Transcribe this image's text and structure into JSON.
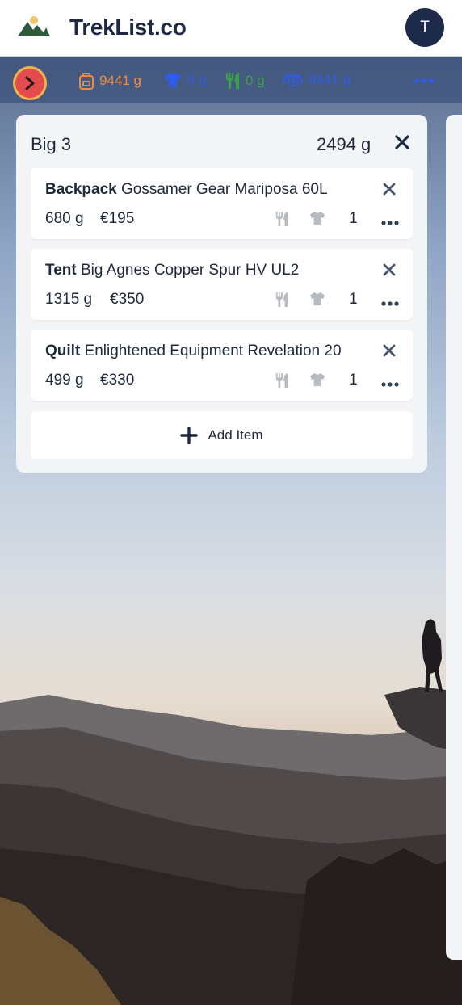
{
  "header": {
    "brand": "TrekList.co",
    "avatar_initial": "T"
  },
  "stats": {
    "base_weight": "9441 g",
    "worn_weight": "0 g",
    "food_weight": "0 g",
    "total_weight": "9441 g",
    "colors": {
      "base": "#f08a3c",
      "worn": "#2f5bea",
      "food": "#3aa148",
      "total": "#2f5bea"
    }
  },
  "category": {
    "title": "Big 3",
    "weight": "2494 g",
    "items": [
      {
        "type": "Backpack",
        "name": "Gossamer Gear Mariposa 60L",
        "weight": "680 g",
        "price": "€195",
        "qty": "1"
      },
      {
        "type": "Tent",
        "name": "Big Agnes Copper Spur HV UL2",
        "weight": "1315 g",
        "price": "€350",
        "qty": "1"
      },
      {
        "type": "Quilt",
        "name": "Enlightened Equipment Revelation 20",
        "weight": "499 g",
        "price": "€330",
        "qty": "1"
      }
    ],
    "add_item_label": "Add Item"
  },
  "icons": [
    "mountain-logo-icon",
    "chevron-right-icon",
    "backpack-icon",
    "tshirt-icon",
    "utensils-icon",
    "scale-icon",
    "ellipsis-icon",
    "close-icon",
    "plus-icon"
  ]
}
